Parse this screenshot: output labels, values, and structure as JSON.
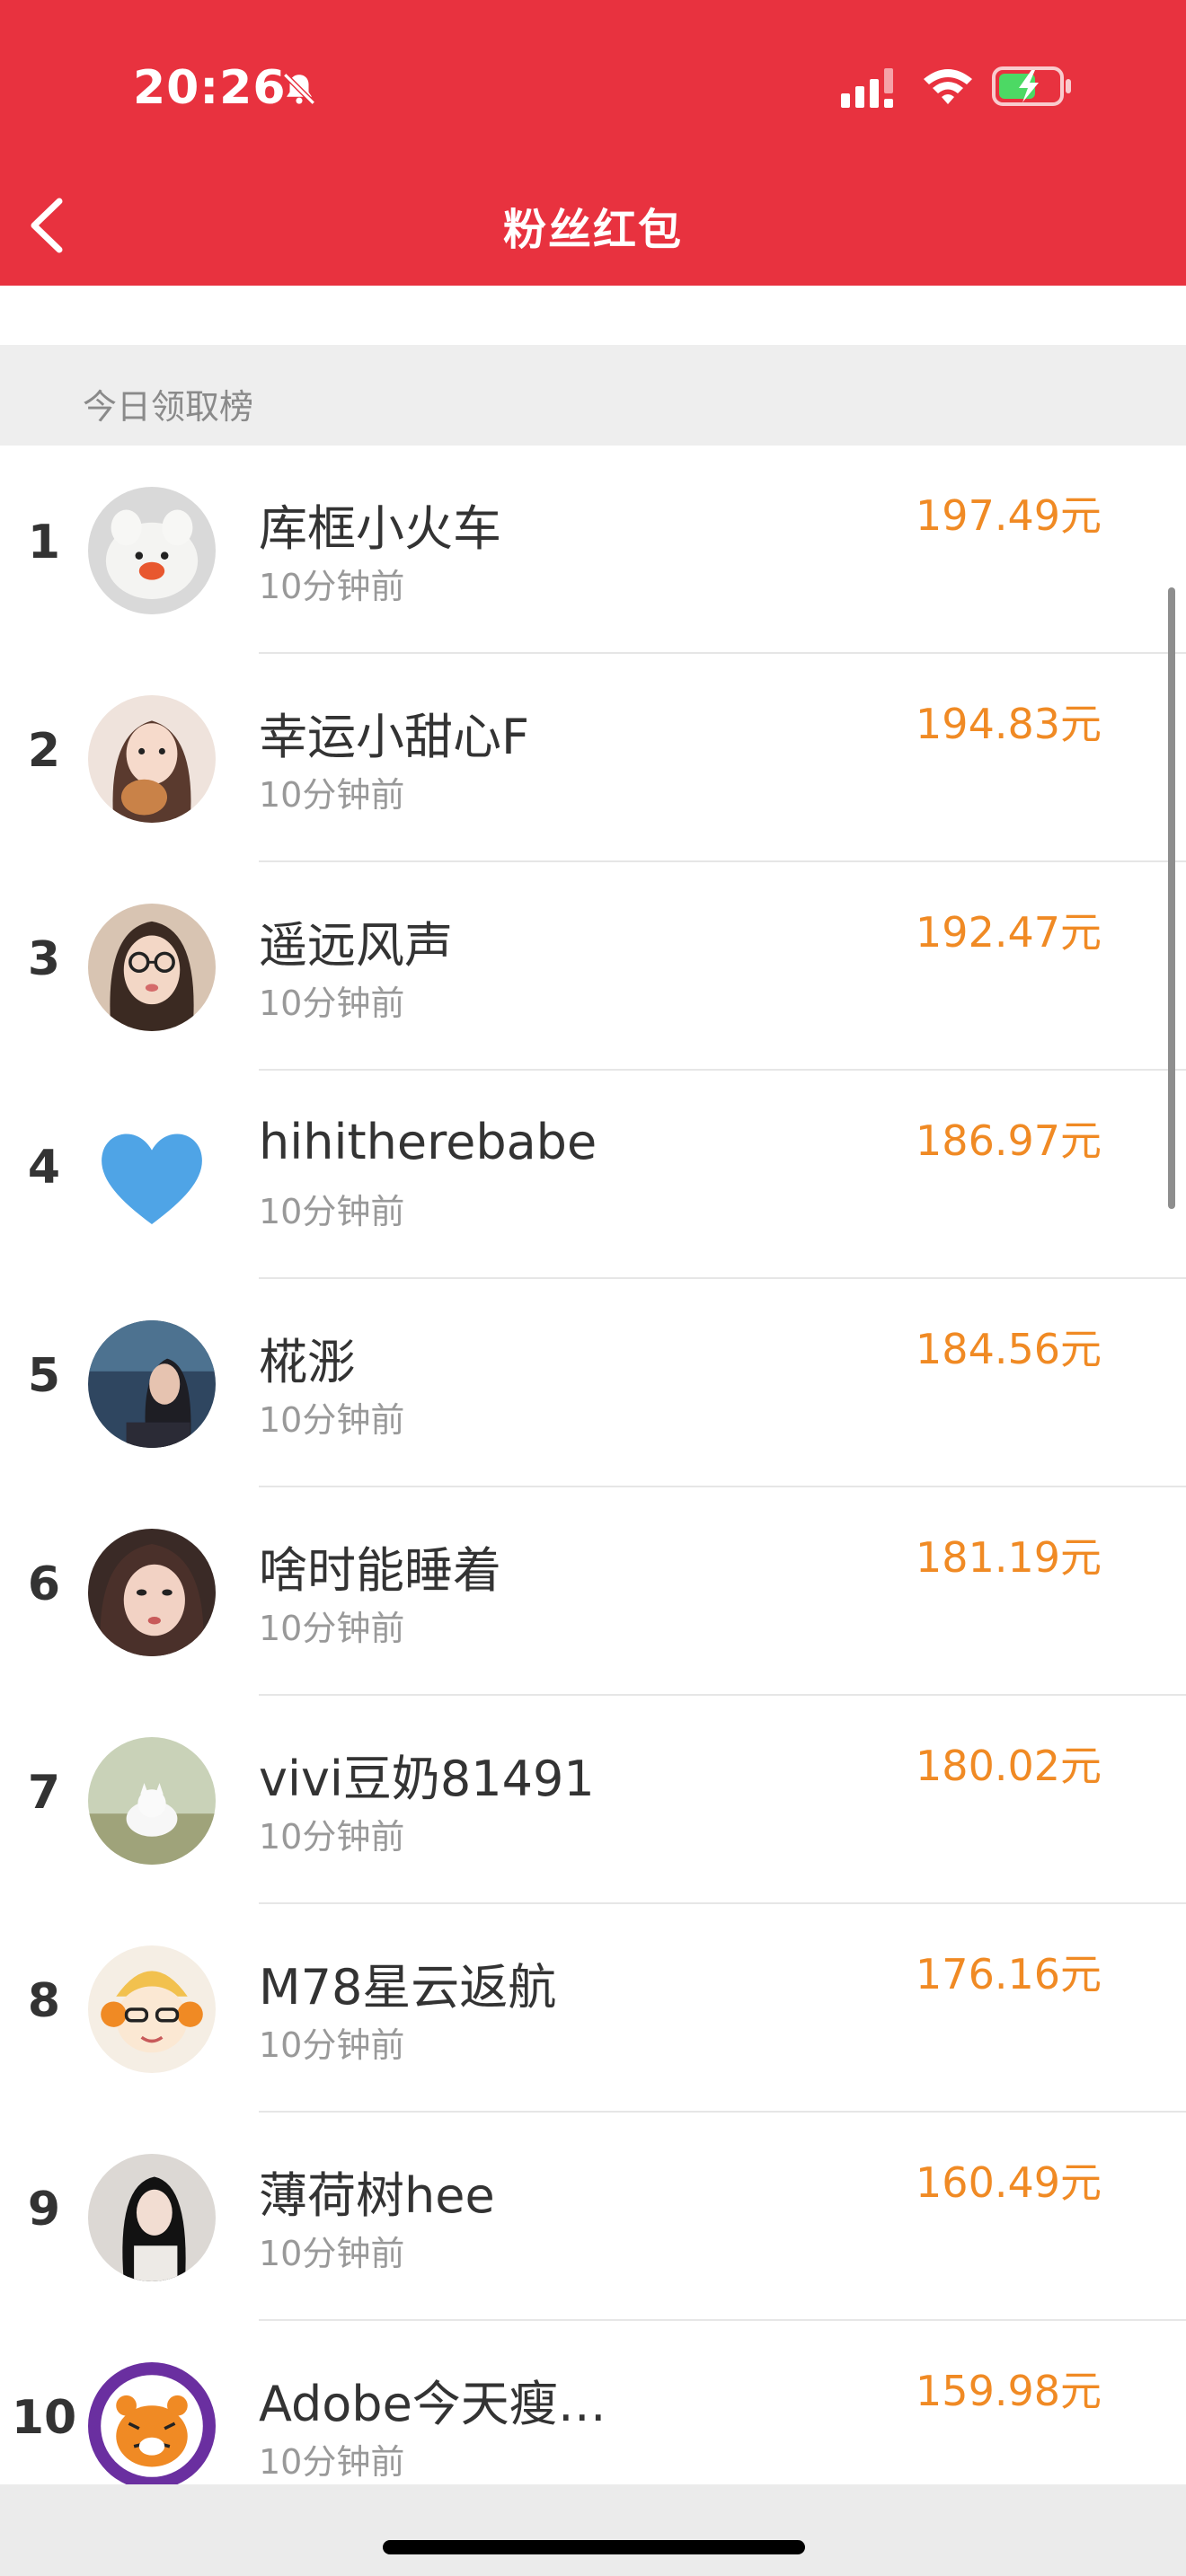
{
  "status_bar": {
    "time": "20:26",
    "icons": [
      "bell-off-icon",
      "cellular-signal-icon",
      "wifi-icon",
      "battery-charging-icon"
    ]
  },
  "nav": {
    "title": "粉丝红包",
    "back_icon": "chevron-left-icon"
  },
  "section": {
    "title": "今日领取榜"
  },
  "colors": {
    "header_bg": "#E8323F",
    "amount": "#F08A24",
    "section_bg": "#EEEEEE"
  },
  "leaderboard": [
    {
      "rank": "1",
      "name": "库框小火车",
      "time": "10分钟前",
      "amount": "197.49元"
    },
    {
      "rank": "2",
      "name": "幸运小甜心F",
      "time": "10分钟前",
      "amount": "194.83元"
    },
    {
      "rank": "3",
      "name": "遥远风声",
      "time": "10分钟前",
      "amount": "192.47元"
    },
    {
      "rank": "4",
      "name": "hihitherebabe",
      "time": "10分钟前",
      "amount": "186.97元"
    },
    {
      "rank": "5",
      "name": "椛浵",
      "time": "10分钟前",
      "amount": "184.56元"
    },
    {
      "rank": "6",
      "name": "啥时能睡着",
      "time": "10分钟前",
      "amount": "181.19元"
    },
    {
      "rank": "7",
      "name": "vivi豆奶81491",
      "time": "10分钟前",
      "amount": "180.02元"
    },
    {
      "rank": "8",
      "name": "M78星云返航",
      "time": "10分钟前",
      "amount": "176.16元"
    },
    {
      "rank": "9",
      "name": "薄荷树hee",
      "time": "10分钟前",
      "amount": "160.49元"
    },
    {
      "rank": "10",
      "name": "Adobe今天瘦…",
      "time": "10分钟前",
      "amount": "159.98元"
    }
  ]
}
